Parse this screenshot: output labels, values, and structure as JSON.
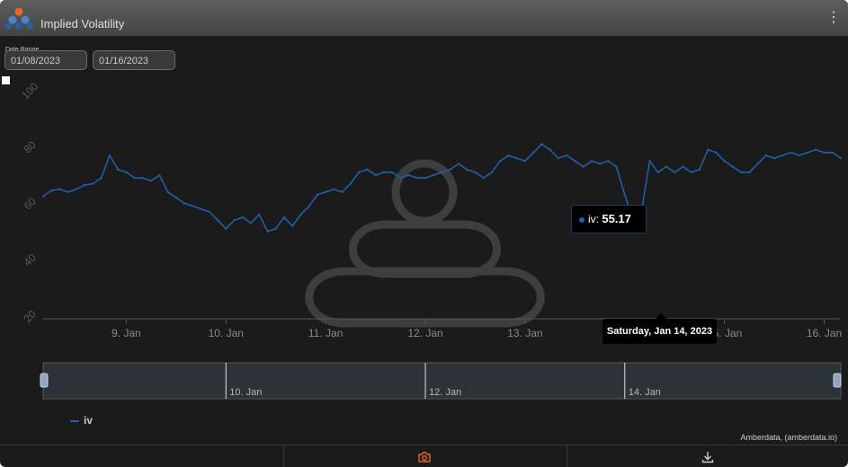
{
  "header": {
    "title": "Implied Volatility",
    "menu_icon": "kebab-menu-icon",
    "logo_icon": "amberdata-logo-icon"
  },
  "range": {
    "label": "Date Range",
    "start": "01/08/2023",
    "end": "01/16/2023"
  },
  "tooltip": {
    "series": "iv",
    "separator": ": ",
    "value": "55.17",
    "date": "Saturday, Jan 14, 2023"
  },
  "credits": "Amberdata, (amberdata.io)",
  "footer": {
    "camera_icon": "camera-icon",
    "download_icon": "download-icon"
  },
  "colors": {
    "series": "#1f5fa8",
    "accent": "#e8632a",
    "background": "#1b1b1b"
  },
  "chart_data": {
    "type": "line",
    "title": "Implied Volatility",
    "ylim": [
      20,
      100
    ],
    "yticks": [
      "20",
      "40",
      "60",
      "80",
      "100"
    ],
    "xlim": [
      "2023-01-08T04:00",
      "2023-01-16T04:00"
    ],
    "xticks": [
      {
        "label": "9. Jan",
        "t": "2023-01-09"
      },
      {
        "label": "10. Jan",
        "t": "2023-01-10"
      },
      {
        "label": "11. Jan",
        "t": "2023-01-11"
      },
      {
        "label": "12. Jan",
        "t": "2023-01-12"
      },
      {
        "label": "13. Jan",
        "t": "2023-01-13"
      },
      {
        "label": "14. Jan",
        "t": "2023-01-14"
      },
      {
        "label": "15. Jan",
        "t": "2023-01-15"
      },
      {
        "label": "16. Jan",
        "t": "2023-01-16"
      }
    ],
    "navigator_ticks": [
      {
        "label": "10. Jan",
        "t": "2023-01-10"
      },
      {
        "label": "12. Jan",
        "t": "2023-01-12"
      },
      {
        "label": "14. Jan",
        "t": "2023-01-14"
      }
    ],
    "grid": false,
    "legend": "bottom-left",
    "series": [
      {
        "name": "iv",
        "x": [
          "2023-01-08T04:00",
          "2023-01-08T06:00",
          "2023-01-08T08:00",
          "2023-01-08T10:00",
          "2023-01-08T12:00",
          "2023-01-08T14:00",
          "2023-01-08T16:00",
          "2023-01-08T18:00",
          "2023-01-08T20:00",
          "2023-01-08T22:00",
          "2023-01-09T00:00",
          "2023-01-09T02:00",
          "2023-01-09T04:00",
          "2023-01-09T06:00",
          "2023-01-09T08:00",
          "2023-01-09T10:00",
          "2023-01-09T12:00",
          "2023-01-09T14:00",
          "2023-01-09T16:00",
          "2023-01-09T18:00",
          "2023-01-09T20:00",
          "2023-01-09T22:00",
          "2023-01-10T00:00",
          "2023-01-10T02:00",
          "2023-01-10T04:00",
          "2023-01-10T06:00",
          "2023-01-10T08:00",
          "2023-01-10T10:00",
          "2023-01-10T12:00",
          "2023-01-10T14:00",
          "2023-01-10T16:00",
          "2023-01-10T18:00",
          "2023-01-10T20:00",
          "2023-01-10T22:00",
          "2023-01-11T00:00",
          "2023-01-11T02:00",
          "2023-01-11T04:00",
          "2023-01-11T06:00",
          "2023-01-11T08:00",
          "2023-01-11T10:00",
          "2023-01-11T12:00",
          "2023-01-11T14:00",
          "2023-01-11T16:00",
          "2023-01-11T18:00",
          "2023-01-11T20:00",
          "2023-01-11T22:00",
          "2023-01-12T00:00",
          "2023-01-12T02:00",
          "2023-01-12T04:00",
          "2023-01-12T06:00",
          "2023-01-12T08:00",
          "2023-01-12T10:00",
          "2023-01-12T12:00",
          "2023-01-12T14:00",
          "2023-01-12T16:00",
          "2023-01-12T18:00",
          "2023-01-12T20:00",
          "2023-01-12T22:00",
          "2023-01-13T00:00",
          "2023-01-13T02:00",
          "2023-01-13T04:00",
          "2023-01-13T06:00",
          "2023-01-13T08:00",
          "2023-01-13T10:00",
          "2023-01-13T12:00",
          "2023-01-13T14:00",
          "2023-01-13T16:00",
          "2023-01-13T18:00",
          "2023-01-13T20:00",
          "2023-01-13T22:00",
          "2023-01-14T00:00",
          "2023-01-14T02:00",
          "2023-01-14T04:00",
          "2023-01-14T06:00",
          "2023-01-14T08:00",
          "2023-01-14T10:00",
          "2023-01-14T12:00",
          "2023-01-14T14:00",
          "2023-01-14T16:00",
          "2023-01-14T18:00",
          "2023-01-14T20:00",
          "2023-01-14T22:00",
          "2023-01-15T00:00",
          "2023-01-15T02:00",
          "2023-01-15T04:00",
          "2023-01-15T06:00",
          "2023-01-15T08:00",
          "2023-01-15T10:00",
          "2023-01-15T12:00",
          "2023-01-15T14:00",
          "2023-01-15T16:00",
          "2023-01-15T18:00",
          "2023-01-15T20:00",
          "2023-01-15T22:00",
          "2023-01-16T00:00",
          "2023-01-16T02:00",
          "2023-01-16T04:00"
        ],
        "values": [
          63.5,
          65.5,
          66,
          65,
          66,
          67.5,
          68,
          70,
          78,
          73,
          72,
          70,
          70,
          69,
          71,
          65,
          63,
          61,
          60,
          59,
          58,
          55,
          52,
          55,
          56,
          54,
          57,
          51,
          52,
          56,
          53,
          57,
          60,
          64,
          65,
          66,
          65,
          68,
          72,
          73,
          71,
          72,
          72,
          70,
          71,
          70,
          70,
          71,
          72,
          73,
          75,
          73,
          72,
          70,
          72,
          76,
          78,
          77,
          76,
          79,
          82,
          80,
          77,
          78,
          76,
          74,
          76,
          75,
          76,
          74,
          64,
          55.17,
          58,
          76,
          72,
          74,
          72,
          74,
          72,
          73,
          80,
          79,
          76,
          74,
          72,
          72,
          75,
          78,
          77,
          78,
          79,
          78,
          79,
          80,
          79,
          79,
          77
        ]
      }
    ]
  }
}
